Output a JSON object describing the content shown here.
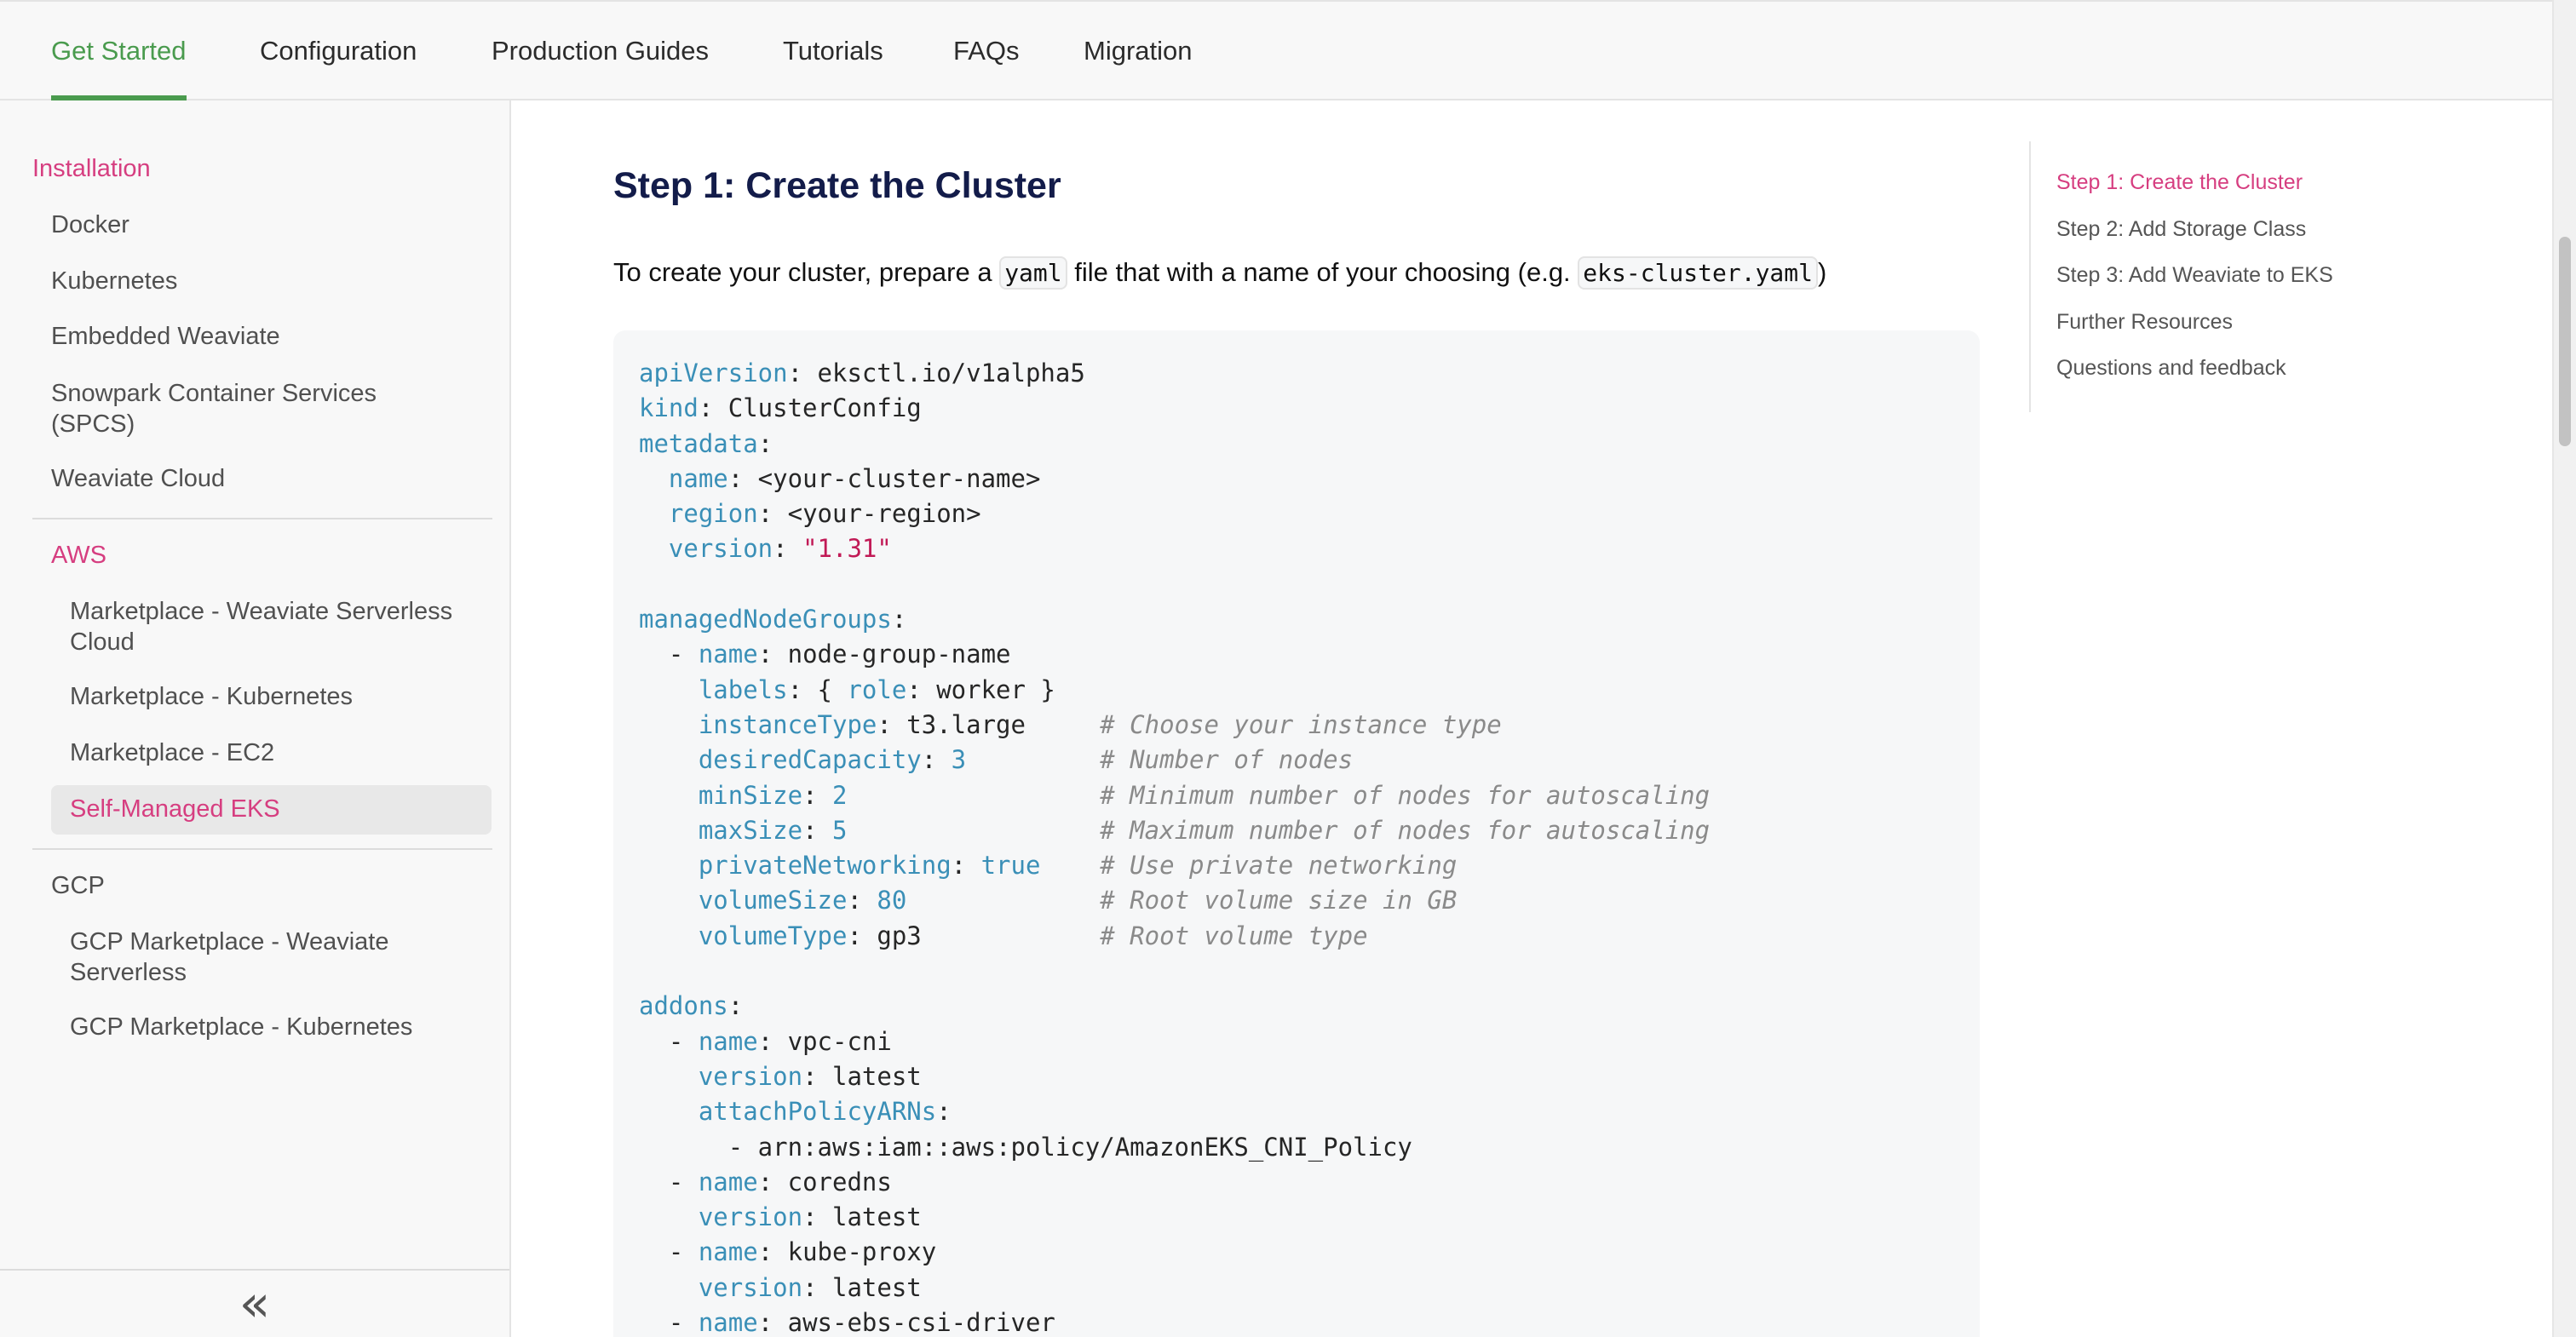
{
  "topnav": {
    "tabs": [
      {
        "label": "Get Started",
        "active": true
      },
      {
        "label": "Configuration",
        "active": false
      },
      {
        "label": "Production Guides",
        "active": false
      },
      {
        "label": "Tutorials",
        "active": false
      },
      {
        "label": "FAQs",
        "active": false
      },
      {
        "label": "Migration",
        "active": false
      }
    ]
  },
  "sidebar": {
    "installation": "Installation",
    "docker": "Docker",
    "kubernetes": "Kubernetes",
    "embedded": "Embedded Weaviate",
    "snowpark_line1": "Snowpark Container Services",
    "snowpark_line2": "(SPCS)",
    "weaviate_cloud": "Weaviate Cloud",
    "aws": "AWS",
    "mp_serverless_line1": "Marketplace - Weaviate Serverless",
    "mp_serverless_line2": "Cloud",
    "mp_kubernetes": "Marketplace - Kubernetes",
    "mp_ec2": "Marketplace - EC2",
    "self_managed_eks": "Self-Managed EKS",
    "gcp": "GCP",
    "gcp_serverless_line1": "GCP Marketplace - Weaviate",
    "gcp_serverless_line2": "Serverless",
    "gcp_kubernetes": "GCP Marketplace - Kubernetes",
    "collapse_icon": "double-chevron-left-icon"
  },
  "main": {
    "title": "Step 1: Create the Cluster",
    "intro_before": "To create your cluster, prepare a ",
    "intro_code1": "yaml",
    "intro_middle": " file that with a name of your choosing (e.g. ",
    "intro_code2": "eks-cluster.yaml",
    "intro_after": ")"
  },
  "toc": {
    "items": [
      {
        "label": "Step 1: Create the Cluster",
        "active": true
      },
      {
        "label": "Step 2: Add Storage Class",
        "active": false
      },
      {
        "label": "Step 3: Add Weaviate to EKS",
        "active": false
      },
      {
        "label": "Further Resources",
        "active": false
      },
      {
        "label": "Questions and feedback",
        "active": false
      }
    ]
  },
  "code": {
    "lines": [
      [
        [
          "k",
          "apiVersion"
        ],
        [
          "p",
          ": eksctl.io/v1alpha5"
        ]
      ],
      [
        [
          "k",
          "kind"
        ],
        [
          "p",
          ": ClusterConfig"
        ]
      ],
      [
        [
          "k",
          "metadata"
        ],
        [
          "p",
          ":"
        ]
      ],
      [
        [
          "p",
          "  "
        ],
        [
          "k",
          "name"
        ],
        [
          "p",
          ": <your-cluster-name>"
        ]
      ],
      [
        [
          "p",
          "  "
        ],
        [
          "k",
          "region"
        ],
        [
          "p",
          ": <your-region>"
        ]
      ],
      [
        [
          "p",
          "  "
        ],
        [
          "k",
          "version"
        ],
        [
          "p",
          ": "
        ],
        [
          "s",
          "\"1.31\""
        ]
      ],
      [],
      [
        [
          "k",
          "managedNodeGroups"
        ],
        [
          "p",
          ":"
        ]
      ],
      [
        [
          "p",
          "  - "
        ],
        [
          "k",
          "name"
        ],
        [
          "p",
          ": node-group-name"
        ]
      ],
      [
        [
          "p",
          "    "
        ],
        [
          "k",
          "labels"
        ],
        [
          "p",
          ": { "
        ],
        [
          "k",
          "role"
        ],
        [
          "p",
          ": worker }"
        ]
      ],
      [
        [
          "p",
          "    "
        ],
        [
          "k",
          "instanceType"
        ],
        [
          "p",
          ": t3.large     "
        ],
        [
          "c",
          "# Choose your instance type"
        ]
      ],
      [
        [
          "p",
          "    "
        ],
        [
          "k",
          "desiredCapacity"
        ],
        [
          "p",
          ": "
        ],
        [
          "k",
          "3"
        ],
        [
          "p",
          "         "
        ],
        [
          "c",
          "# Number of nodes"
        ]
      ],
      [
        [
          "p",
          "    "
        ],
        [
          "k",
          "minSize"
        ],
        [
          "p",
          ": "
        ],
        [
          "k",
          "2"
        ],
        [
          "p",
          "                 "
        ],
        [
          "c",
          "# Minimum number of nodes for autoscaling"
        ]
      ],
      [
        [
          "p",
          "    "
        ],
        [
          "k",
          "maxSize"
        ],
        [
          "p",
          ": "
        ],
        [
          "k",
          "5"
        ],
        [
          "p",
          "                 "
        ],
        [
          "c",
          "# Maximum number of nodes for autoscaling"
        ]
      ],
      [
        [
          "p",
          "    "
        ],
        [
          "k",
          "privateNetworking"
        ],
        [
          "p",
          ": "
        ],
        [
          "k",
          "true"
        ],
        [
          "p",
          "    "
        ],
        [
          "c",
          "# Use private networking"
        ]
      ],
      [
        [
          "p",
          "    "
        ],
        [
          "k",
          "volumeSize"
        ],
        [
          "p",
          ": "
        ],
        [
          "k",
          "80"
        ],
        [
          "p",
          "             "
        ],
        [
          "c",
          "# Root volume size in GB"
        ]
      ],
      [
        [
          "p",
          "    "
        ],
        [
          "k",
          "volumeType"
        ],
        [
          "p",
          ": gp3            "
        ],
        [
          "c",
          "# Root volume type"
        ]
      ],
      [],
      [
        [
          "k",
          "addons"
        ],
        [
          "p",
          ":"
        ]
      ],
      [
        [
          "p",
          "  - "
        ],
        [
          "k",
          "name"
        ],
        [
          "p",
          ": vpc-cni"
        ]
      ],
      [
        [
          "p",
          "    "
        ],
        [
          "k",
          "version"
        ],
        [
          "p",
          ": latest"
        ]
      ],
      [
        [
          "p",
          "    "
        ],
        [
          "k",
          "attachPolicyARNs"
        ],
        [
          "p",
          ":"
        ]
      ],
      [
        [
          "p",
          "      - arn:aws:iam::aws:policy/AmazonEKS_CNI_Policy"
        ]
      ],
      [
        [
          "p",
          "  - "
        ],
        [
          "k",
          "name"
        ],
        [
          "p",
          ": coredns"
        ]
      ],
      [
        [
          "p",
          "    "
        ],
        [
          "k",
          "version"
        ],
        [
          "p",
          ": latest"
        ]
      ],
      [
        [
          "p",
          "  - "
        ],
        [
          "k",
          "name"
        ],
        [
          "p",
          ": kube-proxy"
        ]
      ],
      [
        [
          "p",
          "    "
        ],
        [
          "k",
          "version"
        ],
        [
          "p",
          ": latest"
        ]
      ],
      [
        [
          "p",
          "  - "
        ],
        [
          "k",
          "name"
        ],
        [
          "p",
          ": aws-ebs-csi-driver"
        ]
      ]
    ]
  }
}
